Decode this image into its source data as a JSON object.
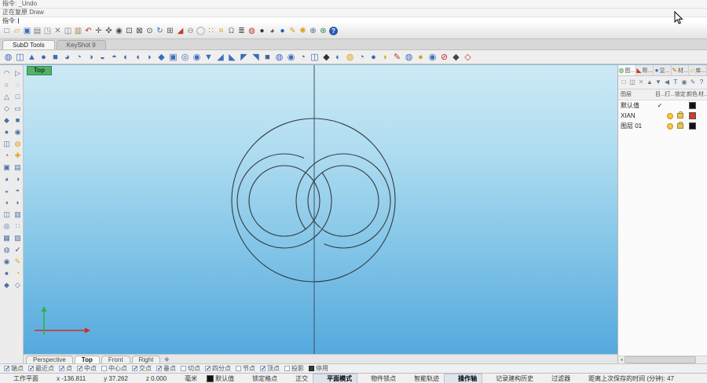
{
  "command": {
    "history": [
      "指令: _Undo",
      "正在复原 Draw"
    ],
    "prompt_label": "指令:"
  },
  "toolbar_tabs": [
    {
      "name": "toolbar-tab-subd-tools",
      "label": "SubD Tools",
      "active": true
    },
    {
      "name": "toolbar-tab-keyshot",
      "label": "KeyShot 9",
      "active": false
    }
  ],
  "main_toolbar_icons": [
    {
      "name": "new-file-icon",
      "glyph": "□",
      "color": "#666666"
    },
    {
      "name": "open-folder-icon",
      "glyph": "▱",
      "color": "#d9a21b"
    },
    {
      "name": "save-icon",
      "glyph": "▣",
      "color": "#3b6db8"
    },
    {
      "name": "print-icon",
      "glyph": "▤",
      "color": "#777777"
    },
    {
      "name": "export-icon",
      "glyph": "◳",
      "color": "#888888"
    },
    {
      "name": "cut-icon",
      "glyph": "✕",
      "color": "#777777"
    },
    {
      "name": "copy-icon",
      "glyph": "◫",
      "color": "#777777"
    },
    {
      "name": "paste-icon",
      "glyph": "▥",
      "color": "#a8824f"
    },
    {
      "name": "undo-icon",
      "glyph": "↶",
      "color": "#b03030"
    },
    {
      "name": "pan-icon",
      "glyph": "✛",
      "color": "#555555"
    },
    {
      "name": "move-icon",
      "glyph": "✜",
      "color": "#555555"
    },
    {
      "name": "zoom-icon",
      "glyph": "◉",
      "color": "#444444"
    },
    {
      "name": "zoom-window-icon",
      "glyph": "⊡",
      "color": "#444444"
    },
    {
      "name": "zoom-extents-icon",
      "glyph": "⊠",
      "color": "#444444"
    },
    {
      "name": "zoom-selected-icon",
      "glyph": "⊙",
      "color": "#444444"
    },
    {
      "name": "rotate-view-icon",
      "glyph": "↻",
      "color": "#3b6db8"
    },
    {
      "name": "four-viewports-icon",
      "glyph": "⊞",
      "color": "#555555"
    },
    {
      "name": "shade-icon",
      "glyph": "◢",
      "color": "#c0392b"
    },
    {
      "name": "hide-object-icon",
      "glyph": "⊖",
      "color": "#888888"
    },
    {
      "name": "show-object-icon",
      "glyph": "◯",
      "color": "#888888"
    },
    {
      "name": "select-points-icon",
      "glyph": "∷",
      "color": "#b07020"
    },
    {
      "name": "lamp-icon",
      "glyph": "¤",
      "color": "#d9a21b"
    },
    {
      "name": "lock-object-icon",
      "glyph": "Ω",
      "color": "#777777"
    },
    {
      "name": "layer-state-icon",
      "glyph": "≣",
      "color": "#444444"
    },
    {
      "name": "color-wheel-icon",
      "glyph": "◍",
      "color": "#c0392b"
    },
    {
      "name": "render-icon",
      "glyph": "●",
      "color": "#333333"
    },
    {
      "name": "render-preview-icon",
      "glyph": "◕",
      "color": "#555555"
    },
    {
      "name": "sphere-icon",
      "glyph": "●",
      "color": "#1a5fb4"
    },
    {
      "name": "paint-icon",
      "glyph": "✎",
      "color": "#d9a21b"
    },
    {
      "name": "settings-icon",
      "glyph": "✺",
      "color": "#d9a21b"
    },
    {
      "name": "grid-options-icon",
      "glyph": "⊕",
      "color": "#556677"
    },
    {
      "name": "earth-icon",
      "glyph": "⊛",
      "color": "#2d7d46"
    },
    {
      "name": "help-icon",
      "glyph": "?",
      "color": "#ffffff",
      "badge": true
    }
  ],
  "subd_toolbar_icons": [
    {
      "name": "subd-tool-1-icon",
      "glyph": "◍",
      "color": "#3b6db8"
    },
    {
      "name": "subd-tool-2-icon",
      "glyph": "◫",
      "color": "#3b6db8"
    },
    {
      "name": "subd-tool-3-icon",
      "glyph": "▲",
      "color": "#3b6db8"
    },
    {
      "name": "subd-tool-4-icon",
      "glyph": "●",
      "color": "#3b6db8"
    },
    {
      "name": "subd-tool-5-icon",
      "glyph": "■",
      "color": "#3b6db8"
    },
    {
      "name": "subd-tool-6-icon",
      "glyph": "◕",
      "color": "#3b6db8"
    },
    {
      "name": "subd-tool-7-icon",
      "glyph": "◔",
      "color": "#3b6db8"
    },
    {
      "name": "subd-tool-8-icon",
      "glyph": "◑",
      "color": "#3b6db8"
    },
    {
      "name": "subd-tool-9-icon",
      "glyph": "◒",
      "color": "#3b6db8"
    },
    {
      "name": "subd-tool-10-icon",
      "glyph": "◓",
      "color": "#3b6db8"
    },
    {
      "name": "subd-tool-11-icon",
      "glyph": "◐",
      "color": "#46648c"
    },
    {
      "name": "subd-tool-12-icon",
      "glyph": "◖",
      "color": "#3b6db8"
    },
    {
      "name": "subd-tool-13-icon",
      "glyph": "◗",
      "color": "#3b6db8"
    },
    {
      "name": "subd-tool-14-icon",
      "glyph": "◆",
      "color": "#3b6db8"
    },
    {
      "name": "subd-tool-15-icon",
      "glyph": "▣",
      "color": "#3b6db8"
    },
    {
      "name": "subd-tool-16-icon",
      "glyph": "◎",
      "color": "#3b6db8"
    },
    {
      "name": "subd-tool-17-icon",
      "glyph": "◉",
      "color": "#3b6db8"
    },
    {
      "name": "subd-tool-18-icon",
      "glyph": "▼",
      "color": "#3b6db8"
    },
    {
      "name": "subd-tool-19-icon",
      "glyph": "◢",
      "color": "#3b6db8"
    },
    {
      "name": "subd-tool-20-icon",
      "glyph": "◣",
      "color": "#3b6db8"
    },
    {
      "name": "subd-tool-21-icon",
      "glyph": "◤",
      "color": "#3b6db8"
    },
    {
      "name": "subd-tool-22-icon",
      "glyph": "◥",
      "color": "#3b6db8"
    },
    {
      "name": "subd-tool-23-icon",
      "glyph": "■",
      "color": "#46648c"
    },
    {
      "name": "subd-tool-24-icon",
      "glyph": "◍",
      "color": "#3b6db8"
    },
    {
      "name": "subd-tool-25-icon",
      "glyph": "◉",
      "color": "#3b6db8"
    },
    {
      "name": "subd-tool-26-icon",
      "glyph": "◔",
      "color": "#46648c"
    },
    {
      "name": "subd-tool-27-icon",
      "glyph": "◫",
      "color": "#3b6db8"
    },
    {
      "name": "subd-tool-28-icon",
      "glyph": "◆",
      "color": "#333333"
    },
    {
      "name": "subd-tool-29-icon",
      "glyph": "◐",
      "color": "#3b6db8"
    },
    {
      "name": "subd-tool-30-icon",
      "glyph": "◍",
      "color": "#d9a21b"
    },
    {
      "name": "subd-tool-31-icon",
      "glyph": "◔",
      "color": "#46648c"
    },
    {
      "name": "subd-tool-32-icon",
      "glyph": "●",
      "color": "#3b6db8"
    },
    {
      "name": "subd-tool-33-icon",
      "glyph": "◗",
      "color": "#d9a21b"
    },
    {
      "name": "subd-tool-34-icon",
      "glyph": "✎",
      "color": "#c0392b"
    },
    {
      "name": "subd-tool-35-icon",
      "glyph": "◍",
      "color": "#3b6db8"
    },
    {
      "name": "subd-tool-36-icon",
      "glyph": "●",
      "color": "#d9a21b"
    },
    {
      "name": "subd-tool-37-icon",
      "glyph": "◉",
      "color": "#3b6db8"
    },
    {
      "name": "subd-no-render-icon",
      "glyph": "⊘",
      "color": "#cc2a2a"
    },
    {
      "name": "subd-tool-39-icon",
      "glyph": "◆",
      "color": "#444444"
    },
    {
      "name": "subd-tool-40-icon",
      "glyph": "◇",
      "color": "#c0392b"
    }
  ],
  "left_toolbar_icons": [
    {
      "name": "side-tool-1-icon",
      "glyph": "◠",
      "color": "#4a6fa5"
    },
    {
      "name": "side-tool-2-icon",
      "glyph": "▷",
      "color": "#4a6fa5"
    },
    {
      "name": "side-tool-3-icon",
      "glyph": "○",
      "color": "#4a6fa5"
    },
    {
      "name": "side-tool-4-icon",
      "glyph": "◌",
      "color": "#4a6fa5"
    },
    {
      "name": "side-tool-5-icon",
      "glyph": "△",
      "color": "#4a6fa5"
    },
    {
      "name": "side-tool-6-icon",
      "glyph": "□",
      "color": "#4a6fa5"
    },
    {
      "name": "side-tool-7-icon",
      "glyph": "◇",
      "color": "#4a6fa5"
    },
    {
      "name": "side-tool-8-icon",
      "glyph": "▭",
      "color": "#4a6fa5"
    },
    {
      "name": "side-tool-9-icon",
      "glyph": "◆",
      "color": "#4a6fa5"
    },
    {
      "name": "side-tool-10-icon",
      "glyph": "■",
      "color": "#4a6fa5"
    },
    {
      "name": "side-tool-11-icon",
      "glyph": "●",
      "color": "#4a6fa5"
    },
    {
      "name": "side-tool-12-icon",
      "glyph": "◉",
      "color": "#4a6fa5"
    },
    {
      "name": "side-tool-13-icon",
      "glyph": "◫",
      "color": "#4a6fa5"
    },
    {
      "name": "side-tool-14-icon",
      "glyph": "◍",
      "color": "#d9a21b"
    },
    {
      "name": "side-tool-15-icon",
      "glyph": "◔",
      "color": "#c0392b"
    },
    {
      "name": "side-tool-16-icon",
      "glyph": "✚",
      "color": "#d9a21b"
    },
    {
      "name": "side-tool-17-icon",
      "glyph": "▣",
      "color": "#4a6fa5"
    },
    {
      "name": "side-tool-18-icon",
      "glyph": "▤",
      "color": "#4a6fa5"
    },
    {
      "name": "side-tool-19-icon",
      "glyph": "◕",
      "color": "#4a6fa5"
    },
    {
      "name": "side-tool-20-icon",
      "glyph": "◑",
      "color": "#4a6fa5"
    },
    {
      "name": "side-tool-21-icon",
      "glyph": "◒",
      "color": "#4a6fa5"
    },
    {
      "name": "side-tool-22-icon",
      "glyph": "◓",
      "color": "#4a6fa5"
    },
    {
      "name": "side-tool-23-icon",
      "glyph": "◖",
      "color": "#4a6fa5"
    },
    {
      "name": "side-tool-24-icon",
      "glyph": "◗",
      "color": "#4a6fa5"
    },
    {
      "name": "side-tool-25-icon",
      "glyph": "◫",
      "color": "#4a6fa5"
    },
    {
      "name": "side-tool-26-icon",
      "glyph": "▥",
      "color": "#4a6fa5"
    },
    {
      "name": "side-tool-27-icon",
      "glyph": "◎",
      "color": "#4a6fa5"
    },
    {
      "name": "side-tool-28-icon",
      "glyph": "∷",
      "color": "#4a6fa5"
    },
    {
      "name": "side-tool-29-icon",
      "glyph": "▦",
      "color": "#4a6fa5"
    },
    {
      "name": "side-tool-30-icon",
      "glyph": "▧",
      "color": "#4a6fa5"
    },
    {
      "name": "side-tool-31-icon",
      "glyph": "◍",
      "color": "#4a6fa5"
    },
    {
      "name": "side-tool-32-icon",
      "glyph": "✓",
      "color": "#333333"
    },
    {
      "name": "side-tool-33-icon",
      "glyph": "◉",
      "color": "#4a6fa5"
    },
    {
      "name": "side-tool-34-icon",
      "glyph": "✎",
      "color": "#d9a21b"
    },
    {
      "name": "side-tool-35-icon",
      "glyph": "●",
      "color": "#4a6fa5"
    },
    {
      "name": "side-tool-36-icon",
      "glyph": "◔",
      "color": "#d9a21b"
    },
    {
      "name": "side-tool-37-icon",
      "glyph": "◆",
      "color": "#4a6fa5"
    },
    {
      "name": "side-tool-38-icon",
      "glyph": "◇",
      "color": "#4a6fa5"
    }
  ],
  "viewport": {
    "title": "Top",
    "new_tab_glyph": "◆",
    "tabs": [
      {
        "name": "viewport-tab-perspective",
        "label": "Perspective",
        "active": false
      },
      {
        "name": "viewport-tab-top",
        "label": "Top",
        "active": true
      },
      {
        "name": "viewport-tab-front",
        "label": "Front",
        "active": false
      },
      {
        "name": "viewport-tab-right",
        "label": "Right",
        "active": false
      }
    ],
    "axis_x_color": "#d42a2a",
    "axis_y_color": "#2fae46",
    "curve_color": "#333a40"
  },
  "panel": {
    "tabs": [
      {
        "name": "panel-tab-layers",
        "label": "图...",
        "glyph": "◍",
        "color": "#3f9d5a",
        "active": true
      },
      {
        "name": "panel-tab-help",
        "label": "帮...",
        "glyph": "◣",
        "color": "#c3342b",
        "active": false
      },
      {
        "name": "panel-tab-display",
        "label": "显...",
        "glyph": "●",
        "color": "#2d6fbe",
        "active": false
      },
      {
        "name": "panel-tab-materials",
        "label": "材...",
        "glyph": "✎",
        "color": "#b8742c",
        "active": false
      },
      {
        "name": "panel-tab-libraries",
        "label": "库...",
        "glyph": "▱",
        "color": "#d9a21b",
        "active": false
      }
    ],
    "toolbar_icons": [
      {
        "name": "new-layer-icon",
        "glyph": "□",
        "color": "#667788"
      },
      {
        "name": "new-sublayer-icon",
        "glyph": "◫",
        "color": "#667788"
      },
      {
        "name": "delete-layer-icon",
        "glyph": "✕",
        "color": "#999999"
      },
      {
        "name": "move-up-icon",
        "glyph": "▲",
        "color": "#667788"
      },
      {
        "name": "move-down-icon",
        "glyph": "▼",
        "color": "#667788"
      },
      {
        "name": "collapse-icon",
        "glyph": "◀",
        "color": "#667788"
      },
      {
        "name": "filter-icon",
        "glyph": "T",
        "color": "#2a5db0"
      },
      {
        "name": "find-layer-icon",
        "glyph": "◉",
        "color": "#667788"
      },
      {
        "name": "layer-tools-icon",
        "glyph": "✎",
        "color": "#667788"
      },
      {
        "name": "panel-help-icon",
        "glyph": "?",
        "color": "#2a5db0"
      }
    ],
    "columns": [
      "图层",
      "目...",
      "打...",
      "锁定",
      "颜色",
      "材..."
    ],
    "current_glyph": "✓",
    "layers": [
      {
        "name": "默认值",
        "current": true,
        "on": false,
        "lock": false,
        "color": "#111111"
      },
      {
        "name": "XIAN",
        "current": false,
        "on": true,
        "lock": true,
        "color": "#d03a2b"
      },
      {
        "name": "图层 01",
        "current": false,
        "on": true,
        "lock": true,
        "color": "#111111"
      }
    ]
  },
  "osnap": {
    "items": [
      {
        "name": "osnap-end",
        "label": "端点",
        "checked": true
      },
      {
        "name": "osnap-near",
        "label": "最近点",
        "checked": true
      },
      {
        "name": "osnap-point",
        "label": "点",
        "checked": true
      },
      {
        "name": "osnap-mid",
        "label": "中点",
        "checked": true
      },
      {
        "name": "osnap-cen",
        "label": "中心点",
        "checked": false
      },
      {
        "name": "osnap-int",
        "label": "交点",
        "checked": true
      },
      {
        "name": "osnap-perp",
        "label": "垂点",
        "checked": true
      },
      {
        "name": "osnap-tan",
        "label": "切点",
        "checked": false
      },
      {
        "name": "osnap-quad",
        "label": "四分点",
        "checked": true
      },
      {
        "name": "osnap-knot",
        "label": "节点",
        "checked": false
      },
      {
        "name": "osnap-vertex",
        "label": "顶点",
        "checked": true
      },
      {
        "name": "osnap-project",
        "label": "投影",
        "checked": false
      },
      {
        "name": "osnap-disable",
        "label": "停用",
        "checked": false,
        "dark": true
      }
    ]
  },
  "statusbar": {
    "items": [
      {
        "name": "cplane-pane",
        "label": "工作平面"
      },
      {
        "name": "x-coordinate",
        "label": "x -136.811"
      },
      {
        "name": "y-coordinate",
        "label": "y 37.262"
      },
      {
        "name": "z-coordinate",
        "label": "z 0.000"
      },
      {
        "name": "units-pane",
        "label": "毫米"
      },
      {
        "name": "layer-pane",
        "label": "默认值",
        "swatch": true,
        "color": "#111111"
      },
      {
        "name": "grid-snap-toggle",
        "label": "锁定格点"
      },
      {
        "name": "ortho-toggle",
        "label": "正交"
      },
      {
        "name": "planar-toggle",
        "label": "平面模式",
        "active": true
      },
      {
        "name": "osnap-toggle",
        "label": "物件锁点"
      },
      {
        "name": "smarttrack-toggle",
        "label": "智能轨迹"
      },
      {
        "name": "gumball-toggle",
        "label": "操作轴",
        "active": true
      },
      {
        "name": "record-history-toggle",
        "label": "记录建构历史"
      },
      {
        "name": "filter-toggle",
        "label": "过滤器"
      },
      {
        "name": "autosave-timer",
        "label": "距离上次保存的时间 (分钟): 47"
      }
    ]
  }
}
